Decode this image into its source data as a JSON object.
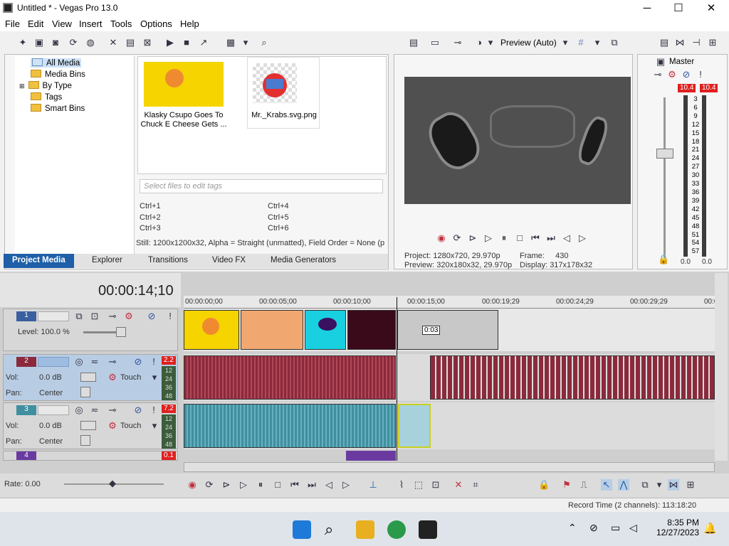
{
  "window": {
    "title": "Untitled * - Vegas Pro 13.0",
    "minimize": "─",
    "maximize": "☐",
    "close": "✕"
  },
  "menu": [
    "File",
    "Edit",
    "View",
    "Insert",
    "Tools",
    "Options",
    "Help"
  ],
  "media_tree": [
    "All Media",
    "Media Bins",
    "By Type",
    "Tags",
    "Smart Bins"
  ],
  "media_items": [
    {
      "label": "Klasky Csupo Goes To Chuck E Cheese Gets ..."
    },
    {
      "label": "Mr._Krabs.svg.png"
    }
  ],
  "tags": {
    "placeholder": "Select files to edit tags",
    "shortcuts": [
      "Ctrl+1",
      "Ctrl+2",
      "Ctrl+3",
      "Ctrl+4",
      "Ctrl+5",
      "Ctrl+6"
    ]
  },
  "media_status": "Still: 1200x1200x32, Alpha = Straight (unmatted), Field Order = None (p",
  "bottom_tabs": [
    "Project Media",
    "Explorer",
    "Transitions",
    "Video FX",
    "Media Generators"
  ],
  "preview": {
    "mode": "Preview (Auto)",
    "project_label": "Project:",
    "project_value": "1280x720, 29.970p",
    "preview_label": "Preview:",
    "preview_value": "320x180x32, 29.970p",
    "frame_label": "Frame:",
    "frame_value": "430",
    "display_label": "Display:",
    "display_value": "317x178x32"
  },
  "master": {
    "label": "Master",
    "peak_left": "10.4",
    "peak_right": "10.4",
    "scale": [
      "3",
      "6",
      "9",
      "12",
      "15",
      "18",
      "21",
      "24",
      "27",
      "30",
      "33",
      "36",
      "39",
      "42",
      "45",
      "48",
      "51",
      "54",
      "57"
    ],
    "bottom_left": "0.0",
    "bottom_right": "0.0"
  },
  "timeline": {
    "timecode": "00:00:14;10",
    "ruler": [
      "00:00:00;00",
      "00:00:05;00",
      "00:00:10;00",
      "00:00:15;00",
      "00:00:19;29",
      "00:00:24;29",
      "00:00:29;29",
      "00:0"
    ],
    "cursor_label": "0:03"
  },
  "tracks": [
    {
      "num": "1",
      "type": "video",
      "level_label": "Level: 100.0 %"
    },
    {
      "num": "2",
      "type": "audio",
      "vol_label": "Vol:",
      "vol": "0.0 dB",
      "pan_label": "Pan:",
      "pan": "Center",
      "mode": "Touch",
      "peak": "2.2",
      "meter": [
        "12",
        "24",
        "36",
        "48"
      ]
    },
    {
      "num": "3",
      "type": "audio",
      "vol_label": "Vol:",
      "vol": "0.0 dB",
      "pan_label": "Pan:",
      "pan": "Center",
      "mode": "Touch",
      "peak": "7.2",
      "meter": [
        "12",
        "24",
        "36",
        "48"
      ]
    },
    {
      "num": "4",
      "type": "audio",
      "peak": "0.1"
    }
  ],
  "transport": {
    "rate": "Rate: 0.00"
  },
  "status": {
    "record_time": "Record Time (2 channels): 113:18:20"
  },
  "taskbar": {
    "time": "8:35 PM",
    "date": "12/27/2023"
  },
  "colors": {
    "accent": "#1e5fa8",
    "video_track": "#3a5fa0",
    "audio2": "#8b2a3c",
    "audio3": "#3f8fa0",
    "peak": "#e02020"
  }
}
